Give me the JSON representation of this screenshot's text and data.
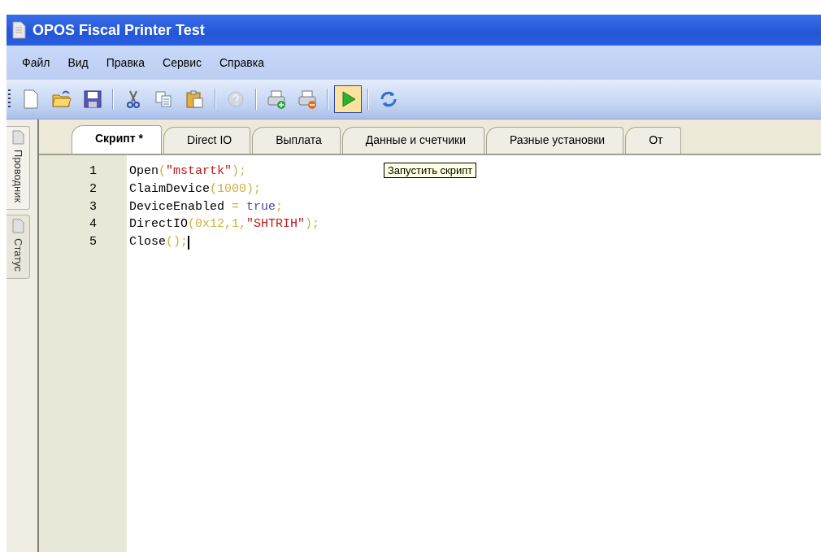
{
  "window": {
    "title": "OPOS Fiscal Printer Test"
  },
  "menu": [
    {
      "label": "Файл"
    },
    {
      "label": "Вид"
    },
    {
      "label": "Правка"
    },
    {
      "label": "Сервис"
    },
    {
      "label": "Справка"
    }
  ],
  "toolbar": [
    {
      "kind": "grip"
    },
    {
      "kind": "new",
      "highlighted": false,
      "disabled": false
    },
    {
      "kind": "open",
      "highlighted": false,
      "disabled": false
    },
    {
      "kind": "save",
      "highlighted": false,
      "disabled": false
    },
    {
      "kind": "separator"
    },
    {
      "kind": "cut",
      "highlighted": false,
      "disabled": false
    },
    {
      "kind": "copy",
      "highlighted": false,
      "disabled": false
    },
    {
      "kind": "paste",
      "highlighted": false,
      "disabled": false
    },
    {
      "kind": "separator"
    },
    {
      "kind": "help",
      "highlighted": false,
      "disabled": true
    },
    {
      "kind": "separator"
    },
    {
      "kind": "printer-add",
      "highlighted": false,
      "disabled": false
    },
    {
      "kind": "printer-remove",
      "highlighted": false,
      "disabled": false
    },
    {
      "kind": "separator"
    },
    {
      "kind": "run",
      "highlighted": true,
      "disabled": false
    },
    {
      "kind": "separator"
    },
    {
      "kind": "refresh",
      "highlighted": false,
      "disabled": false
    }
  ],
  "side_tabs": [
    {
      "label": "Проводник",
      "selected": true
    },
    {
      "label": "Статус",
      "selected": false
    }
  ],
  "tabs": [
    {
      "label": "Скрипт *",
      "selected": true
    },
    {
      "label": "Direct IO",
      "selected": false
    },
    {
      "label": "Выплата",
      "selected": false
    },
    {
      "label": "Данные и счетчики",
      "selected": false
    },
    {
      "label": "Разные установки",
      "selected": false
    },
    {
      "label": "От",
      "selected": false
    }
  ],
  "tooltip": {
    "text": "Запустить скрипт"
  },
  "editor": {
    "lines": [
      {
        "number": "1",
        "tokens": [
          {
            "kind": "ident",
            "text": "Open"
          },
          {
            "kind": "punct",
            "text": "("
          },
          {
            "kind": "string",
            "text": "\"mstartk\""
          },
          {
            "kind": "punct",
            "text": ");"
          }
        ]
      },
      {
        "number": "2",
        "tokens": [
          {
            "kind": "ident",
            "text": "ClaimDevice"
          },
          {
            "kind": "punct",
            "text": "("
          },
          {
            "kind": "number",
            "text": "1000"
          },
          {
            "kind": "punct",
            "text": ");"
          }
        ]
      },
      {
        "number": "3",
        "tokens": [
          {
            "kind": "ident",
            "text": "DeviceEnabled "
          },
          {
            "kind": "punct",
            "text": "= "
          },
          {
            "kind": "keyword",
            "text": "true"
          },
          {
            "kind": "punct",
            "text": ";"
          }
        ]
      },
      {
        "number": "4",
        "tokens": [
          {
            "kind": "ident",
            "text": "DirectIO"
          },
          {
            "kind": "punct",
            "text": "("
          },
          {
            "kind": "number",
            "text": "0x12"
          },
          {
            "kind": "punct",
            "text": ","
          },
          {
            "kind": "number",
            "text": "1"
          },
          {
            "kind": "punct",
            "text": ","
          },
          {
            "kind": "string",
            "text": "\"SHTRIH\""
          },
          {
            "kind": "punct",
            "text": ");"
          }
        ]
      },
      {
        "number": "5",
        "caret": true,
        "tokens": [
          {
            "kind": "ident",
            "text": "Close"
          },
          {
            "kind": "punct",
            "text": "();"
          }
        ]
      }
    ]
  }
}
